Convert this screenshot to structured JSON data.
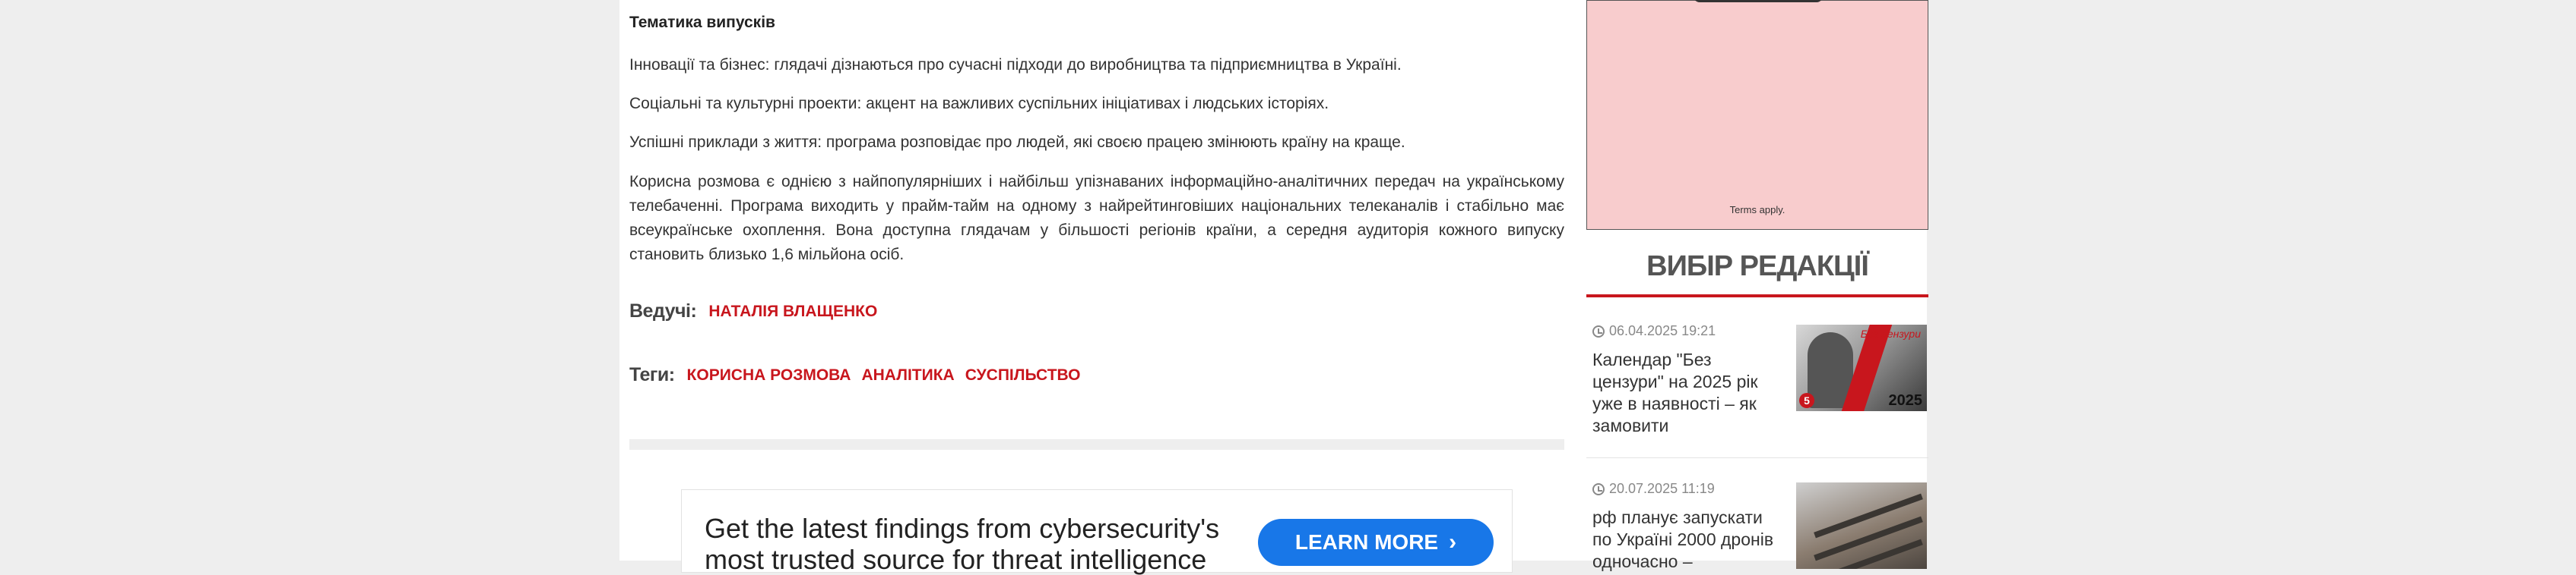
{
  "article": {
    "section_title": "Тематика випусків",
    "paragraphs": [
      "Інновації та бізнес: глядачі дізнаються про сучасні підходи до виробництва та підприємництва в Україні.",
      "Соціальні та культурні проекти: акцент на важливих суспільних ініціативах і людських історіях.",
      " Успішні приклади з життя: програма розповідає про людей, які своєю працею змінюють країну на краще.",
      "Корисна розмова є однією з найпопулярніших і найбільш упізнаваних інформаційно-аналітичних передач на українському телебаченні. Програма виходить у прайм-тайм на одному з найрейтинговіших національних телеканалів і стабільно має всеукраїнське охоплення. Вона доступна глядачам у більшості регіонів країни, а середня аудиторія кожного випуску становить близько 1,6 мільйона осіб."
    ],
    "hosts_label": "Ведучі:",
    "host": "НАТАЛІЯ ВЛАЩЕНКО",
    "tags_label": "Теги:",
    "tags": [
      "КОРИСНА РОЗМОВА",
      "АНАЛІТИКА",
      "СУСПІЛЬСТВО"
    ]
  },
  "ad_banner": {
    "text": "Get the latest findings from cybersecurity's most trusted source for threat intelligence",
    "button_label": "LEARN MORE",
    "button_color": "#1877e8"
  },
  "sidebar": {
    "ad_terms": "Terms apply.",
    "widget_title": "ВИБІР РЕДАКЦІЇ",
    "accent_color": "#c8161d",
    "news": [
      {
        "time": "06.04.2025 19:21",
        "title": "Календар \"Без цензури\" на 2025 рік уже в наявності – як замовити",
        "thumb_year": "2025",
        "thumb_badge": "5",
        "thumb_script": "Без цензури"
      },
      {
        "time": "20.07.2025 11:19",
        "title": "рф планує запускати по Україні 2000 дронів одночасно –"
      }
    ]
  }
}
